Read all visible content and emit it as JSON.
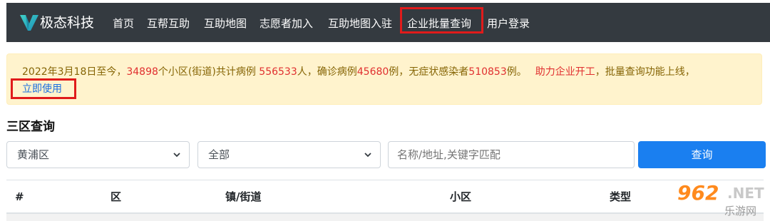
{
  "navbar": {
    "brand": "极态科技",
    "items": [
      {
        "label": "首页"
      },
      {
        "label": "互帮互助"
      },
      {
        "label": "互助地图"
      },
      {
        "label": "志愿者加入"
      },
      {
        "label": "互助地图入驻"
      },
      {
        "label": "企业批量查询"
      },
      {
        "label": "用户登录"
      }
    ],
    "highlighted_item": "企业批量查询"
  },
  "alert": {
    "date_prefix": "2022年3月18日至今，",
    "community_count": "34898",
    "community_text": "个小区(街道)共计病例",
    "total_cases": " 556533",
    "total_suffix": "人，确诊病例",
    "confirmed": "45680",
    "confirmed_suffix": "例，无症状感染者",
    "asymptomatic": "510853",
    "asymptomatic_suffix": "例。",
    "promo_red": "助力企业开工",
    "promo_text": "，批量查询功能上线，",
    "link": "立即使用"
  },
  "section": {
    "title": "三区查询"
  },
  "filters": {
    "district": "黄浦区",
    "scope": "全部",
    "search_placeholder": "名称/地址,关键字匹配",
    "query_button": "查询"
  },
  "table": {
    "headers": [
      "#",
      "区",
      "镇/街道",
      "小区",
      "类型"
    ]
  },
  "watermark": {
    "number": "962",
    "net": ".NET",
    "sub": "乐游网"
  },
  "colors": {
    "navbar_bg": "#343a40",
    "alert_bg": "#fff3cd",
    "alert_text": "#856404",
    "alert_red": "#e02f2f",
    "link": "#1a6fe0",
    "primary_button": "#1a7ff0",
    "highlight_box": "#e01b1b"
  }
}
